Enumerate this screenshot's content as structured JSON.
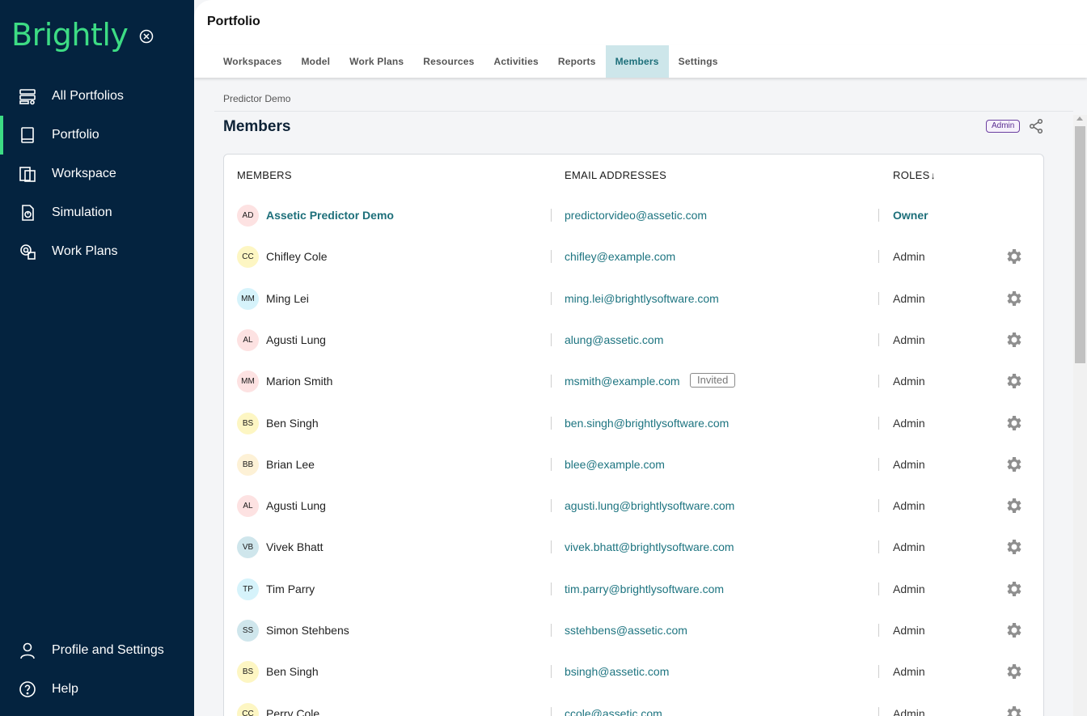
{
  "brand": {
    "logo_text": "Brightly",
    "accent": "#3ddc84",
    "sidebar_bg": "#04233f"
  },
  "sidebar": {
    "items": [
      {
        "label": "All Portfolios",
        "icon": "portfolios-icon"
      },
      {
        "label": "Portfolio",
        "icon": "book-icon",
        "active": true
      },
      {
        "label": "Workspace",
        "icon": "workspace-icon"
      },
      {
        "label": "Simulation",
        "icon": "simulation-icon"
      },
      {
        "label": "Work Plans",
        "icon": "workplans-icon"
      }
    ],
    "bottom": [
      {
        "label": "Profile and Settings",
        "icon": "user-icon"
      },
      {
        "label": "Help",
        "icon": "help-icon"
      }
    ]
  },
  "header": {
    "title": "Portfolio"
  },
  "tabs": [
    "Workspaces",
    "Model",
    "Work Plans",
    "Resources",
    "Activities",
    "Reports",
    "Members",
    "Settings"
  ],
  "active_tab": "Members",
  "breadcrumb": "Predictor Demo",
  "page": {
    "title": "Members",
    "badge": "Admin"
  },
  "table": {
    "headers": {
      "members": "MEMBERS",
      "emails": "EMAIL ADDRESSES",
      "roles": "ROLES"
    },
    "rows": [
      {
        "initials": "AD",
        "name": "Assetic Predictor Demo",
        "email": "predictorvideo@assetic.com",
        "role": "Owner",
        "owner": true,
        "color": "#fde2e2"
      },
      {
        "initials": "CC",
        "name": "Chifley Cole",
        "email": "chifley@example.com",
        "role": "Admin",
        "color": "#fdf6c3"
      },
      {
        "initials": "MM",
        "name": "Ming Lei",
        "email": "ming.lei@brightlysoftware.com",
        "role": "Admin",
        "color": "#d6f3fb"
      },
      {
        "initials": "AL",
        "name": "Agusti Lung",
        "email": "alung@assetic.com",
        "role": "Admin",
        "color": "#fde2e2"
      },
      {
        "initials": "MM",
        "name": "Marion Smith",
        "email": "msmith@example.com",
        "role": "Admin",
        "invited": "Invited",
        "color": "#fde2e2"
      },
      {
        "initials": "BS",
        "name": "Ben Singh",
        "email": "ben.singh@brightlysoftware.com",
        "role": "Admin",
        "color": "#fdf6c3"
      },
      {
        "initials": "BB",
        "name": "Brian Lee",
        "email": "blee@example.com",
        "role": "Admin",
        "color": "#fdf1d6"
      },
      {
        "initials": "AL",
        "name": "Agusti Lung",
        "email": "agusti.lung@brightlysoftware.com",
        "role": "Admin",
        "color": "#fde2e2"
      },
      {
        "initials": "VB",
        "name": "Vivek Bhatt",
        "email": "vivek.bhatt@brightlysoftware.com",
        "role": "Admin",
        "color": "#cfe6ec"
      },
      {
        "initials": "TP",
        "name": "Tim Parry",
        "email": "tim.parry@brightlysoftware.com",
        "role": "Admin",
        "color": "#d6f3fb"
      },
      {
        "initials": "SS",
        "name": "Simon Stehbens",
        "email": "sstehbens@assetic.com",
        "role": "Admin",
        "color": "#cfe6ec"
      },
      {
        "initials": "BS",
        "name": "Ben Singh",
        "email": "bsingh@assetic.com",
        "role": "Admin",
        "color": "#fdf6c3"
      },
      {
        "initials": "CC",
        "name": "Perry Cole",
        "email": "ccole@assetic.com",
        "role": "Admin",
        "color": "#fdf6c3"
      }
    ]
  }
}
